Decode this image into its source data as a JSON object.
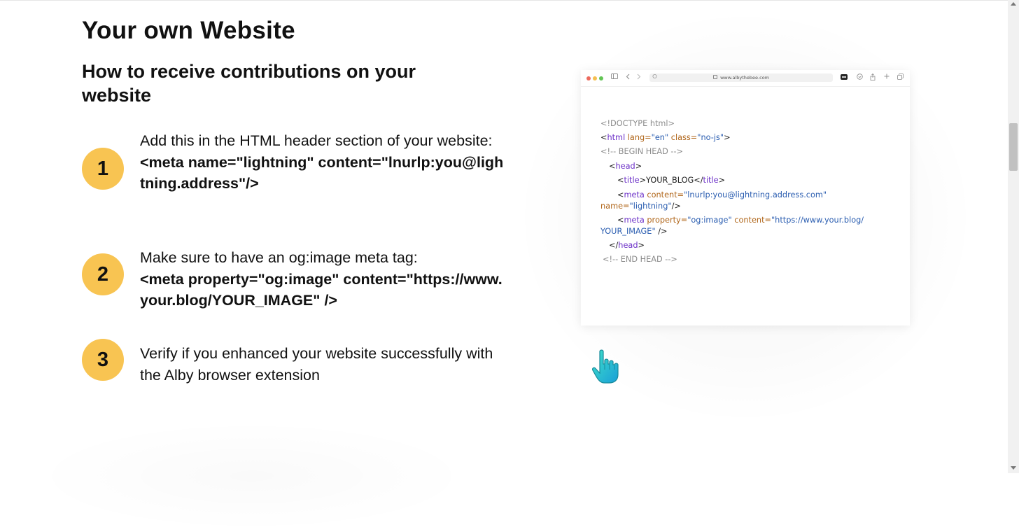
{
  "page": {
    "title": "Your own Website",
    "subtitle": "How to receive contributions on your website"
  },
  "steps": [
    {
      "number": "1",
      "text": "Add this in the HTML header section of your website:",
      "code": "<meta name=\"lightning\" content=\"lnurlp:you@lightning.address\"/>"
    },
    {
      "number": "2",
      "text": "Make sure to have an og:image meta tag:",
      "code": "<meta property=\"og:image\" content=\"https://www.your.blog/YOUR_IMAGE\" />"
    },
    {
      "number": "3",
      "text": "Verify if you enhanced your website successfully with the Alby browser extension",
      "code": ""
    }
  ],
  "browser": {
    "url": "www.albythebee.com",
    "traffic_lights": [
      "#ed6a5e",
      "#f5bf4f",
      "#62c554"
    ],
    "code": {
      "doctype": "<!DOCTYPE html>",
      "html_open": {
        "lt": "<",
        "tag": "html",
        "attr1": " lang=",
        "val1": "\"en\"",
        "attr2": " class=",
        "val2": "\"no-js\"",
        "gt": ">"
      },
      "comment_begin": "<!-- BEGIN HEAD -->",
      "head_open": {
        "lt": "<",
        "tag": "head",
        "gt": ">"
      },
      "title_line": {
        "lt": "<",
        "tag_open": "title",
        "gt": ">",
        "text": "YOUR_BLOG",
        "lt2": "</",
        "tag_close": "title",
        "gt2": ">"
      },
      "meta1": {
        "lt": "<",
        "tag": "meta",
        "attr1": " content=",
        "val1": "\"lnurlp:you@lightning.address.com\"",
        "attr2": "name=",
        "val2": "\"lightning\"",
        "end": "/>"
      },
      "meta2": {
        "lt": "<",
        "tag": "meta",
        "attr1": " property=",
        "val1": "\"og:image\"",
        "attr2": " content=",
        "val2": "\"https://www.your.blog/",
        "val3": "YOUR_IMAGE\"",
        "end": " />"
      },
      "head_close": {
        "lt": "</",
        "tag": "head",
        "gt": ">"
      },
      "comment_end": "<!-- END HEAD -->"
    }
  },
  "icons": {
    "sidebar": "sidebar-icon",
    "back": "chevron-left-icon",
    "forward": "chevron-right-icon",
    "shield": "shield-icon",
    "lock": "lock-icon",
    "extension": "extension-icon",
    "download": "download-icon",
    "share": "share-icon",
    "new_tab": "plus-icon",
    "tabs": "tabs-icon",
    "pointer": "pointing-hand-icon"
  },
  "colors": {
    "step_badge": "#f8c452",
    "tag": "#6a2ec7",
    "attribute": "#b0661a",
    "value": "#2a5db0",
    "comment": "#8b8b8b",
    "hand": "#2fc9b8"
  }
}
